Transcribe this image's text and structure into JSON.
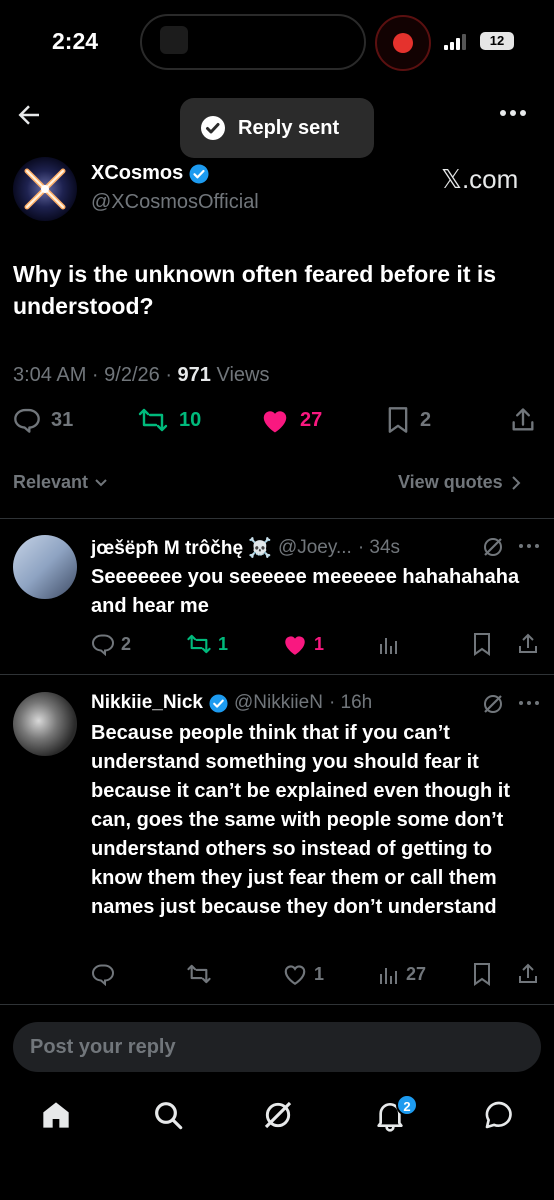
{
  "status_bar": {
    "time": "2:24",
    "battery": "12"
  },
  "toast": {
    "text": "Reply sent"
  },
  "post": {
    "author_name": "XCosmos",
    "author_handle": "@XCosmosOfficial",
    "source_tag": "𝕏.com",
    "text": "Why is the unknown often feared before it is understood?",
    "time_date": "3:04 AM · 9/2/26 ·",
    "views_count": "971",
    "views_label": "Views",
    "replies": "31",
    "reposts": "10",
    "likes": "27",
    "bookmarks": "2"
  },
  "sort": {
    "label": "Relevant",
    "view_quotes": "View quotes"
  },
  "replies": [
    {
      "name": "jœšëpħ M trôčhę ☠️",
      "handle": "@Joey...",
      "time": "· 34s",
      "text": "Seeeeeee you seeeeee meeeeee hahahahaha and hear me",
      "replies": "2",
      "reposts": "1",
      "likes": "1",
      "views": ""
    },
    {
      "name": "Nikkiie_Nick",
      "handle": "@NikkiieN",
      "time": "· 16h",
      "text": "Because people think that if you can’t understand something you should fear it because it can’t be explained even though it can, goes the same with people some don’t understand others so instead of getting to know them they just fear them or call them names just because they don’t understand",
      "replies": "",
      "reposts": "",
      "likes": "1",
      "views": "27"
    }
  ],
  "composer": {
    "placeholder": "Post your reply"
  },
  "nav": {
    "notifications_badge": "2"
  },
  "colors": {
    "background": "#000000",
    "accent": "#1d9bf0",
    "like": "#f91880",
    "repost": "#00ba7c",
    "muted": "#71767b"
  }
}
